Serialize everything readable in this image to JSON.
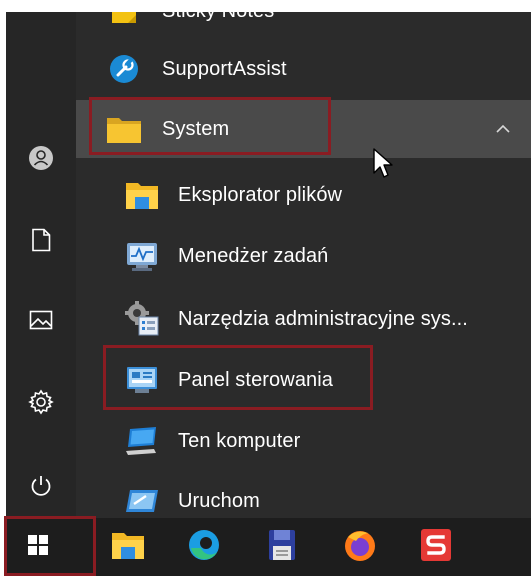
{
  "start_menu": {
    "apps": [
      {
        "label": "Sticky Notes",
        "icon": "sticky-notes-icon"
      },
      {
        "label": "SupportAssist",
        "icon": "support-assist-icon"
      },
      {
        "label": "System",
        "icon": "folder-icon",
        "expanded": true
      },
      {
        "label": "Eksplorator plików",
        "icon": "file-explorer-icon"
      },
      {
        "label": "Menedżer zadań",
        "icon": "task-manager-icon"
      },
      {
        "label": "Narzędzia administracyjne sys...",
        "icon": "admin-tools-icon"
      },
      {
        "label": "Panel sterowania",
        "icon": "control-panel-icon"
      },
      {
        "label": "Ten komputer",
        "icon": "this-pc-icon"
      },
      {
        "label": "Uruchom",
        "icon": "run-icon"
      }
    ]
  },
  "rail": {
    "buttons": [
      "user-icon",
      "documents-icon",
      "pictures-icon",
      "settings-icon",
      "power-icon"
    ]
  },
  "taskbar": {
    "items": [
      "windows-start-icon",
      "file-explorer-icon",
      "edge-icon",
      "save-disk-icon",
      "firefox-icon",
      "s-app-icon"
    ]
  },
  "colors": {
    "menu_bg": "#2b2b2b",
    "rail_bg": "#262626",
    "hover_bg": "#4a4a4a",
    "highlight_border": "#8a1c22",
    "taskbar_bg": "#1d1d1d",
    "text": "#ffffff"
  }
}
